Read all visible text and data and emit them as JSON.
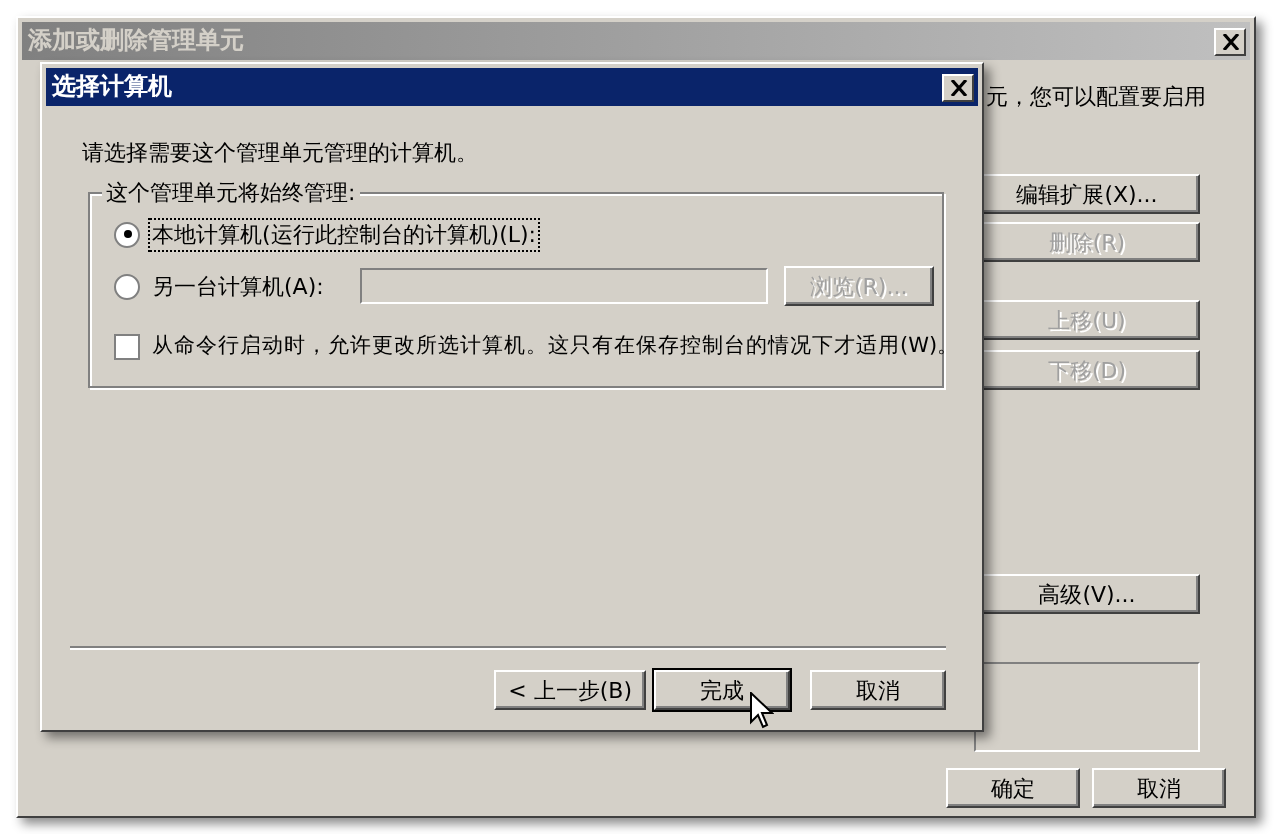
{
  "outer_window": {
    "title": "添加或删除管理单元",
    "active": false,
    "description": "元，您可以配置要启用",
    "buttons": [
      {
        "label": "编辑扩展(X)...",
        "disabled": false
      },
      {
        "label": "删除(R)",
        "disabled": true
      },
      {
        "label": "上移(U)",
        "disabled": true
      },
      {
        "label": "下移(D)",
        "disabled": true
      },
      {
        "label": "高级(V)...",
        "disabled": false
      }
    ],
    "footer_buttons": [
      {
        "label": "确定"
      },
      {
        "label": "取消"
      }
    ]
  },
  "dialog": {
    "title": "选择计算机",
    "prompt": "请选择需要这个管理单元管理的计算机。",
    "group": {
      "label": "这个管理单元将始终管理:",
      "options": [
        {
          "label": "本地计算机(运行此控制台的计算机)(L):",
          "selected": true
        },
        {
          "label": "另一台计算机(A):",
          "selected": false,
          "field_disabled": true,
          "browse": {
            "label": "浏览(R)...",
            "disabled": true
          }
        }
      ],
      "checkbox": {
        "label": "从命令行启动时，允许更改所选计算机。这只有在保存控制台的情况下才适用(W)。",
        "checked": false
      }
    },
    "buttons": [
      {
        "label": "< 上一步(B)",
        "default": false
      },
      {
        "label": "完成",
        "default": true
      },
      {
        "label": "取消",
        "default": false
      }
    ]
  }
}
